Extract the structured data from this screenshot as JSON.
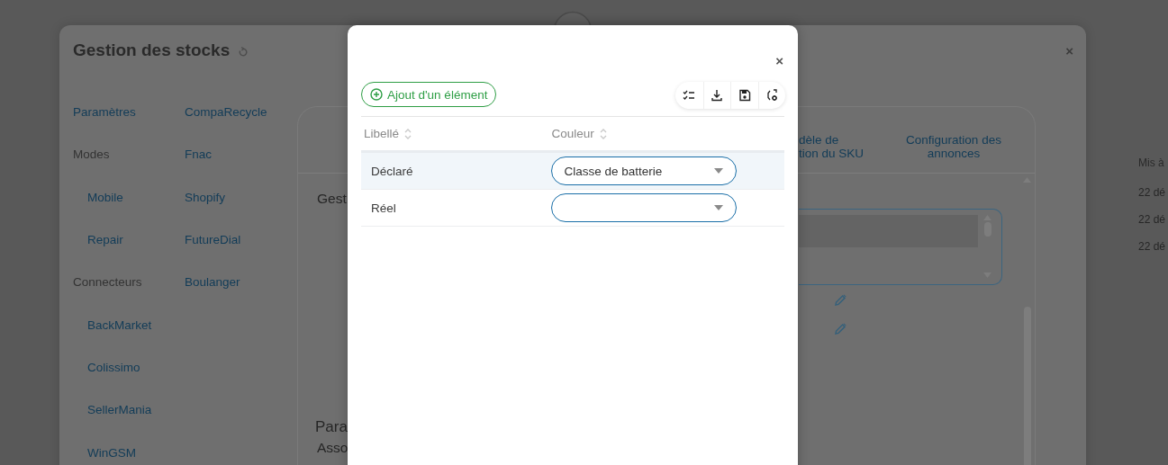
{
  "stock_window": {
    "title": "Gestion des stocks",
    "close": "×",
    "nav": [
      [
        {
          "label": "Paramètres",
          "kind": "link"
        },
        {
          "label": "Modes",
          "kind": "heading"
        },
        {
          "label": "Mobile",
          "kind": "sublink"
        },
        {
          "label": "Repair",
          "kind": "sublink"
        },
        {
          "label": "Connecteurs",
          "kind": "heading"
        },
        {
          "label": "BackMarket",
          "kind": "sublink"
        },
        {
          "label": "Colissimo",
          "kind": "sublink"
        },
        {
          "label": "SellerMania",
          "kind": "sublink"
        },
        {
          "label": "WinGSM",
          "kind": "sublink"
        }
      ],
      [
        {
          "label": "CompaRecycle",
          "kind": "link"
        },
        {
          "label": "Fnac",
          "kind": "link"
        },
        {
          "label": "Shopify",
          "kind": "link"
        },
        {
          "label": "FutureDial",
          "kind": "link"
        },
        {
          "label": "Boulanger",
          "kind": "link"
        }
      ]
    ],
    "panel": {
      "tabs": [
        {
          "lines": [
            "dèle de",
            "tion du SKU"
          ]
        },
        {
          "lines": [
            "Configuration des",
            "annonces"
          ]
        }
      ],
      "section_title": "Gest",
      "section2_title": "Para",
      "section2_subtitle": "Asso"
    }
  },
  "side_table": {
    "header": "Mis à",
    "cells": [
      "22 dé",
      "22 dé",
      "22 dé"
    ]
  },
  "modal": {
    "close": "×",
    "add_button": "Ajout d'un élément",
    "columns": [
      "Libellé",
      "Couleur"
    ],
    "rows": [
      {
        "label": "Déclaré",
        "value": "Classe de batterie",
        "selected": true
      },
      {
        "label": "Réel",
        "selected": false
      }
    ]
  }
}
